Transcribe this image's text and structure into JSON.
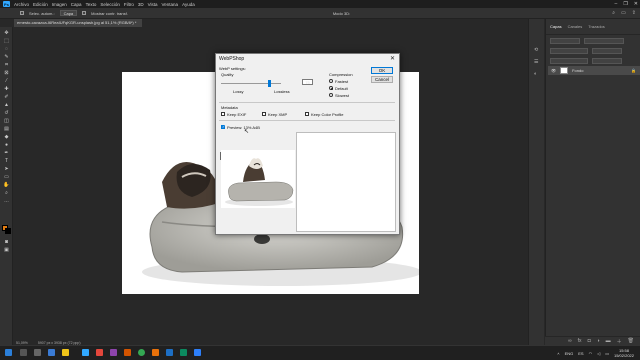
{
  "app": {
    "menu": [
      "Archivo",
      "Edición",
      "Imagen",
      "Capa",
      "Texto",
      "Selección",
      "Filtro",
      "3D",
      "Vista",
      "Ventana",
      "Ayuda"
    ],
    "window_controls": [
      "–",
      "❐",
      "✕"
    ]
  },
  "options_bar": {
    "auto_select_label": "Selec. autom.:",
    "layer_select": "Capa",
    "transform_label": "Mostrar contr. transf.",
    "mode_3d_label": "Modo 3D:",
    "icons": [
      "search-icon",
      "workspace-icon",
      "share-icon"
    ]
  },
  "document_tab": {
    "label": "ernesto-cavazoa-I6ReaIUFqKGR-unsplash.jpg al 51,1% (RGB/8*) *",
    "close": "×"
  },
  "status_bar": {
    "zoom": "51,09%",
    "doc_info": "5907 px x 3938 px (72 ppp)"
  },
  "panel": {
    "tabs": [
      "Capas",
      "Canales",
      "Trazados"
    ],
    "active_tab": "Capas",
    "layer_name": "Fondo",
    "footer_icons": [
      "link-icon",
      "fx-icon",
      "mask-icon",
      "adjust-icon",
      "folder-icon",
      "new-layer-icon",
      "trash-icon"
    ]
  },
  "dialog": {
    "title": "WebPShop",
    "close": "✕",
    "webp_settings_label": "WebP settings:",
    "quality_label": "Quality",
    "quality_value": "75",
    "quality_fraction": 0.75,
    "lossy_label": "Lossy",
    "lossless_label": "Lossless",
    "compression_label": "Compression",
    "compression_options": [
      "Fastest",
      "Default",
      "Slowest"
    ],
    "compression_selected": "Default",
    "ok_label": "OK",
    "cancel_label": "Cancel",
    "metadata_label": "Metadata",
    "keep_exif": "Keep EXIF",
    "keep_xmp": "Keep XMP",
    "keep_color_profile": "Keep Color Profile",
    "preview_label": "Preview: 13% A4B"
  },
  "taskbar": {
    "lang": "ENG",
    "lang_sub": "ES",
    "time": "15:58",
    "date": "15/02/2022"
  },
  "colors": {
    "accent": "#0078d7",
    "ps_blue": "#31a8ff",
    "foreground_swatch": "#e07b12",
    "background_swatch": "#000000"
  }
}
